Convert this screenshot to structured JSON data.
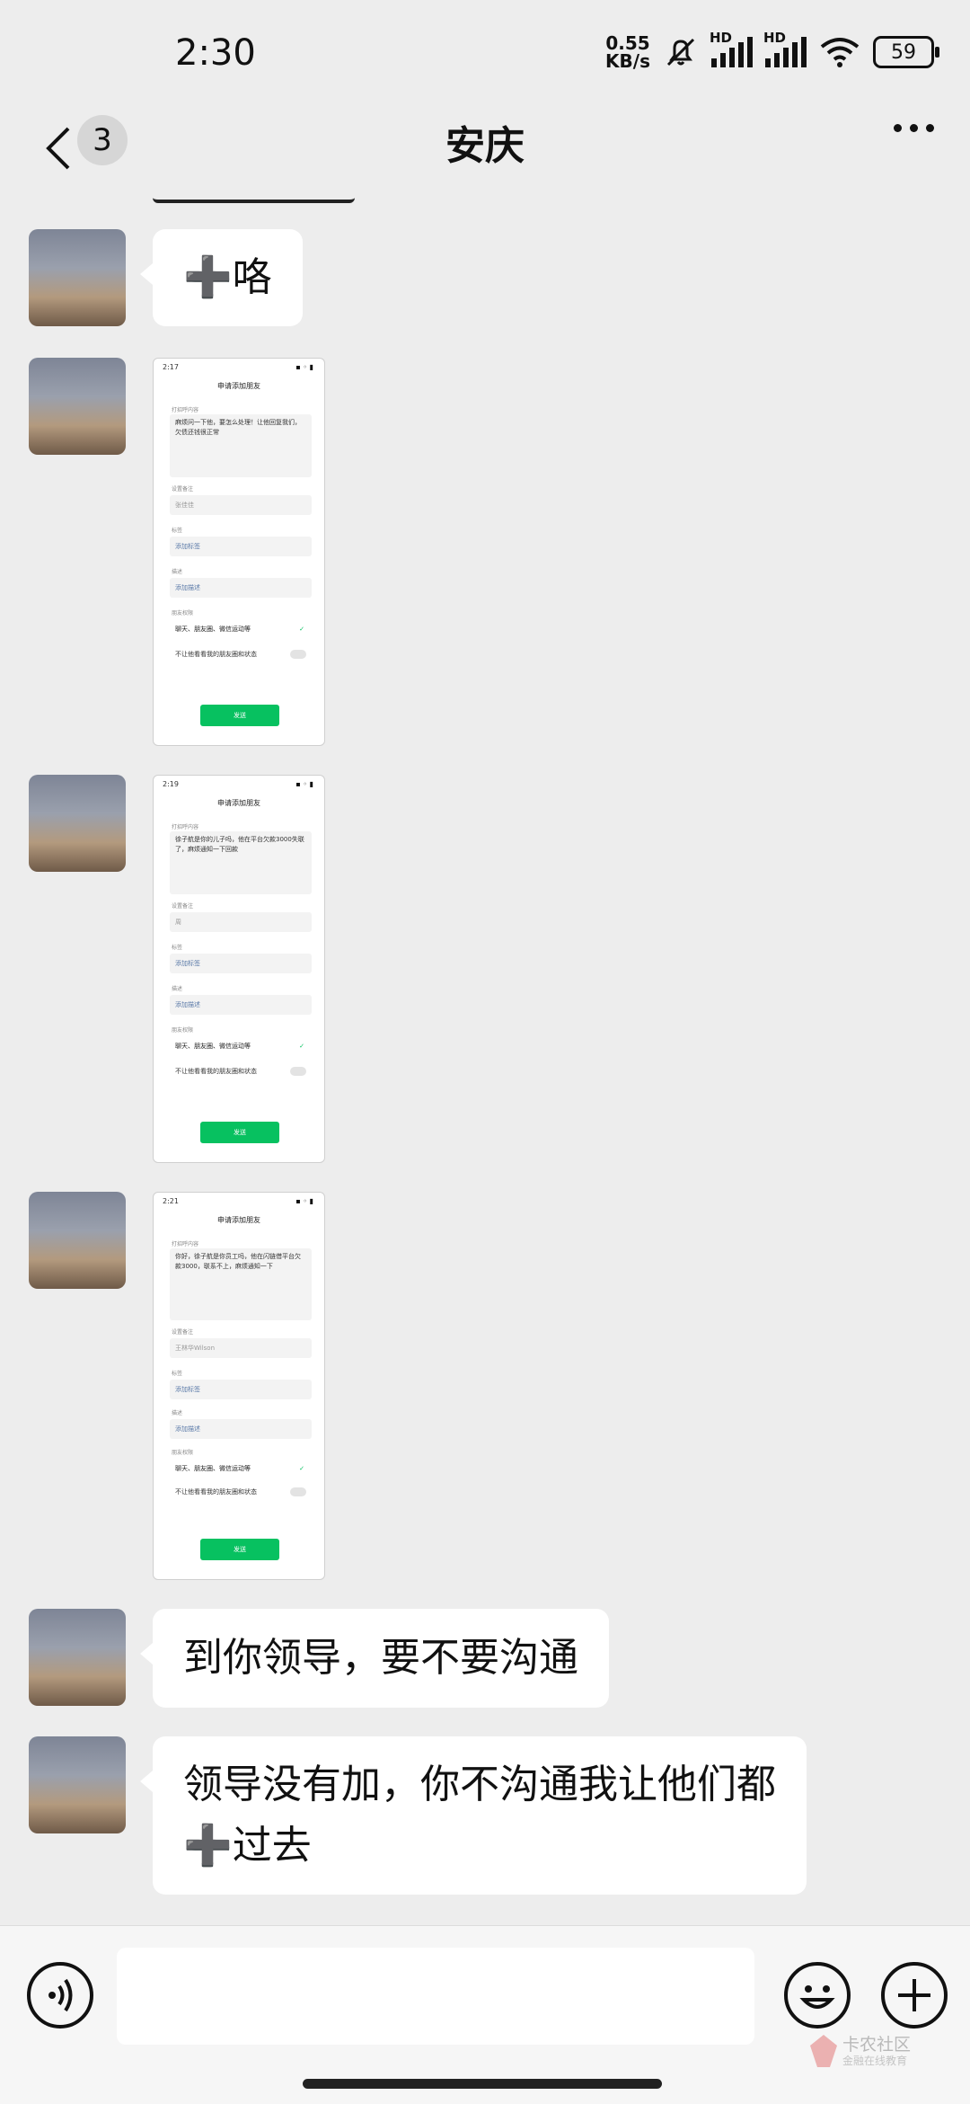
{
  "status_bar": {
    "time": "2:30",
    "speed_value": "0.55",
    "speed_unit": "KB/s",
    "sim1": "HD",
    "sim2": "HD",
    "battery": "59"
  },
  "header": {
    "unread_count": "3",
    "title": "安庆"
  },
  "messages": {
    "m1_text": "➕咯",
    "m5_text": "到你领导，要不要沟通",
    "m6_line1": "领导没有加，你不沟通我让他们都",
    "m6_line2": "➕过去"
  },
  "screenshots": [
    {
      "time": "2:17",
      "header": "申请添加朋友",
      "label_msg": "打招呼内容",
      "msg": "麻烦问一下他，要怎么处理！让他回复我们，欠债还钱很正常",
      "label_remark": "设置备注",
      "remark": "张佳佳",
      "label_tags": "标签",
      "tags": "添加标签",
      "label_desc": "描述",
      "desc": "添加描述",
      "label_perm": "朋友权限",
      "perm": "聊天、朋友圈、微信运动等",
      "hide": "不让他看看我的朋友圈和状态",
      "send": "发送"
    },
    {
      "time": "2:19",
      "header": "申请添加朋友",
      "label_msg": "打招呼内容",
      "msg": "徐子航是你的儿子吗，他在平台欠款3000失联了，麻烦通知一下回款",
      "label_remark": "设置备注",
      "remark": "周",
      "label_tags": "标签",
      "tags": "添加标签",
      "label_desc": "描述",
      "desc": "添加描述",
      "label_perm": "朋友权限",
      "perm": "聊天、朋友圈、微信运动等",
      "hide": "不让他看看我的朋友圈和状态",
      "send": "发送"
    },
    {
      "time": "2:21",
      "header": "申请添加朋友",
      "label_msg": "打招呼内容",
      "msg": "你好，徐子航是你员工吗，他在闪链借平台欠款3000，联系不上，麻烦通知一下",
      "label_remark": "设置备注",
      "remark": "王林华Wilson",
      "label_tags": "标签",
      "tags": "添加标签",
      "label_desc": "描述",
      "desc": "添加描述",
      "label_perm": "朋友权限",
      "perm": "聊天、朋友圈、微信运动等",
      "hide": "不让他看看我的朋友圈和状态",
      "send": "发送"
    }
  ],
  "watermark": {
    "line1": "卡农社区",
    "line2": "金融在线教育"
  },
  "icons": {
    "back": "chevron-left-icon",
    "more": "more-dots-icon",
    "voice": "voice-icon",
    "emoji": "emoji-icon",
    "plus": "plus-icon",
    "mute": "bell-off-icon",
    "wifi": "wifi-icon"
  },
  "colors": {
    "background": "#ededed",
    "bubble": "#ffffff",
    "wechat_green": "#07c160"
  }
}
